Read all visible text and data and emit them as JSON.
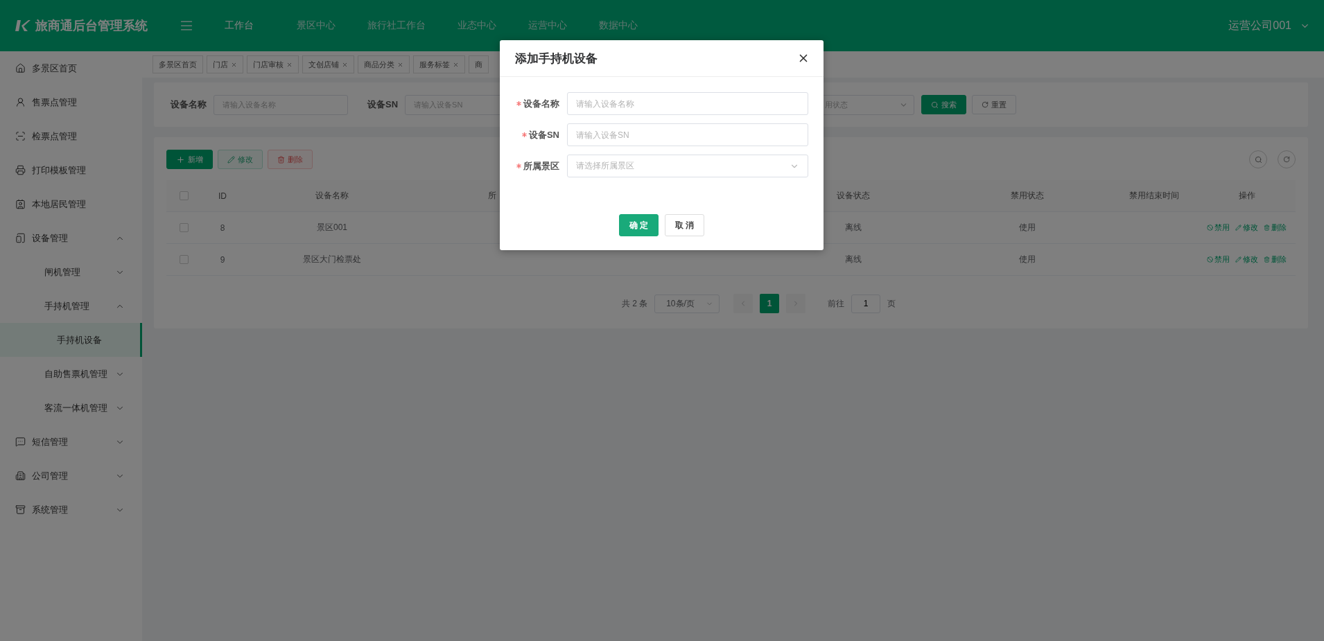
{
  "header": {
    "title": "旅商通后台管理系统",
    "nav": [
      {
        "label": "工作台",
        "selected": true
      },
      {
        "label": "景区中心",
        "selected": false
      },
      {
        "label": "旅行社工作台",
        "selected": false
      },
      {
        "label": "业态中心",
        "selected": false
      },
      {
        "label": "运营中心",
        "selected": false
      },
      {
        "label": "数据中心",
        "selected": false
      }
    ],
    "user": "运营公司001"
  },
  "sidebar": {
    "items": [
      {
        "label": "多景区首页",
        "selected": false
      },
      {
        "label": "售票点管理",
        "selected": false
      },
      {
        "label": "检票点管理",
        "selected": false
      },
      {
        "label": "打印模板管理",
        "selected": false
      },
      {
        "label": "本地居民管理",
        "selected": false
      },
      {
        "label": "设备管理",
        "selected": false,
        "expanded": true,
        "children": [
          {
            "label": "闸机管理",
            "selected": false,
            "expanded": false
          },
          {
            "label": "手持机管理",
            "selected": false,
            "expanded": true,
            "children": [
              {
                "label": "手持机设备",
                "selected": true
              }
            ]
          },
          {
            "label": "自助售票机管理",
            "selected": false,
            "expanded": false
          },
          {
            "label": "客流一体机管理",
            "selected": false,
            "expanded": false
          }
        ]
      },
      {
        "label": "短信管理",
        "selected": false,
        "expanded": false
      },
      {
        "label": "公司管理",
        "selected": false,
        "expanded": false
      },
      {
        "label": "系统管理",
        "selected": false,
        "expanded": false
      }
    ]
  },
  "tabs": [
    {
      "label": "多景区首页",
      "closable": false
    },
    {
      "label": "门店",
      "closable": true
    },
    {
      "label": "门店审核",
      "closable": true
    },
    {
      "label": "文创店铺",
      "closable": true
    },
    {
      "label": "商品分类",
      "closable": true
    },
    {
      "label": "服务标签",
      "closable": true
    },
    {
      "label": "商",
      "closable": false
    }
  ],
  "search": {
    "fields": [
      {
        "label": "设备名称",
        "placeholder": "请输入设备名称"
      },
      {
        "label": "设备SN",
        "placeholder": "请输入设备SN"
      }
    ],
    "select_placeholder": "用状态",
    "search_button": "搜索",
    "reset_button": "重置"
  },
  "toolbar": [
    {
      "label": "新增",
      "kind": "add",
      "disabled": false
    },
    {
      "label": "修改",
      "kind": "edit",
      "disabled": true
    },
    {
      "label": "删除",
      "kind": "delete",
      "disabled": true
    }
  ],
  "table": {
    "all_checked": false,
    "columns": {
      "id": "ID",
      "name": "设备名称",
      "column_3": "所",
      "status": "设备状态",
      "ban_state": "禁用状态",
      "ban_end": "禁用结束时间",
      "actions": "操作"
    },
    "rows": [
      {
        "checked": false,
        "id": "8",
        "name": "景区001",
        "status": "离线",
        "ban_state": "使用",
        "actions": [
          "禁用",
          "修改",
          "删除"
        ]
      },
      {
        "checked": false,
        "id": "9",
        "name": "景区大门检票处",
        "status": "离线",
        "ban_state": "使用",
        "actions": [
          "禁用",
          "修改",
          "删除"
        ]
      }
    ]
  },
  "pagination": {
    "total": "共 2 条",
    "page_size": "10条/页",
    "pages": [
      {
        "label": "1",
        "selected": true
      }
    ],
    "goto_label": "前往",
    "goto_value": "1",
    "goto_suffix": "页"
  },
  "dialog": {
    "title": "添加手持机设备",
    "fields": [
      {
        "label": "设备名称",
        "required": true,
        "kind": "input",
        "placeholder": "请输入设备名称"
      },
      {
        "label": "设备SN",
        "required": true,
        "kind": "input",
        "placeholder": "请输入设备SN"
      },
      {
        "label": "所属景区",
        "required": true,
        "kind": "select",
        "placeholder": "请选择所属景区"
      }
    ],
    "confirm": "确 定",
    "cancel": "取 消"
  }
}
